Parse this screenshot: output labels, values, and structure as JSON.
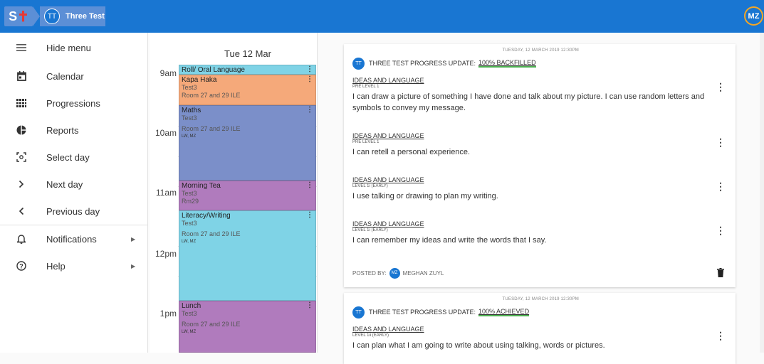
{
  "topbar": {
    "logo_text": "st",
    "breadcrumb": {
      "avatar": "TT",
      "name": "Three Test"
    },
    "user_avatar": "MZ",
    "colors": {
      "bar": "#1976d2",
      "crumb": "#5c8fd6"
    }
  },
  "sidebar": {
    "items": [
      {
        "label": "Hide menu",
        "icon": "menu-icon"
      },
      {
        "label": "Calendar",
        "icon": "calendar-icon"
      },
      {
        "label": "Progressions",
        "icon": "grid-icon"
      },
      {
        "label": "Reports",
        "icon": "pie-chart-icon"
      },
      {
        "label": "Select day",
        "icon": "select-day-icon"
      },
      {
        "label": "Next day",
        "icon": "chevron-right-icon"
      },
      {
        "label": "Previous day",
        "icon": "chevron-left-icon"
      },
      {
        "label": "Notifications",
        "icon": "bell-icon",
        "has_submenu": true
      },
      {
        "label": "Help",
        "icon": "help-icon",
        "has_submenu": true
      }
    ]
  },
  "calendar": {
    "day_label": "Tue 12 Mar",
    "times": [
      "9am",
      "10am",
      "11am",
      "12pm",
      "1pm"
    ],
    "events": [
      {
        "title": "Roll/ Oral Language",
        "subject": "",
        "room": "",
        "who": "",
        "color": "#7fd3e6"
      },
      {
        "title": "Kapa Haka",
        "subject": "Test3",
        "room": "Room 27 and 29 ILE",
        "who": "",
        "color": "#f5a97a"
      },
      {
        "title": "Maths",
        "subject": "Test3",
        "room": "Room 27 and 29 ILE",
        "who": "LW, MZ",
        "color": "#7b8fc9"
      },
      {
        "title": "Morning Tea",
        "subject": "Test3",
        "room": "Rm29",
        "who": "",
        "color": "#b07bbd"
      },
      {
        "title": "Literacy/Writing",
        "subject": "Test3",
        "room": "Room 27 and 29 ILE",
        "who": "LW, MZ",
        "color": "#7fd3e6"
      },
      {
        "title": "Lunch",
        "subject": "Test3",
        "room": "Room 27 and 29 ILE",
        "who": "LW, MZ",
        "color": "#b07bbd"
      }
    ]
  },
  "feed": {
    "cards": [
      {
        "date": "TUESDAY, 12 MARCH 2019 12:30PM",
        "avatar": "TT",
        "title": "THREE TEST  PROGRESS UPDATE:",
        "status": "100% BACKFILLED",
        "items": [
          {
            "category": "IDEAS AND LANGUAGE",
            "level": "PRE LEVEL 1",
            "desc": "I can draw a picture of something I have done and talk about my picture. I can use random letters and symbols to convey my message."
          },
          {
            "category": "IDEAS AND LANGUAGE",
            "level": "PRE LEVEL 1",
            "desc": "I can retell a personal experience."
          },
          {
            "category": "IDEAS AND LANGUAGE",
            "level": "LEVEL 1i (EARLY)",
            "desc": "I use talking or drawing to plan my writing."
          },
          {
            "category": "IDEAS AND LANGUAGE",
            "level": "LEVEL 1i (EARLY)",
            "desc": "I can remember my ideas and write the words that I say."
          }
        ],
        "posted_by_label": "POSTED BY:",
        "poster_avatar": "MZ",
        "poster_name": "MEGHAN ZUYL"
      },
      {
        "date": "TUESDAY, 12 MARCH 2019 12:30PM",
        "avatar": "TT",
        "title": "THREE TEST  PROGRESS UPDATE:",
        "status": "100% ACHIEVED",
        "items": [
          {
            "category": "IDEAS AND LANGUAGE",
            "level": "LEVEL 1ii (EARLY)",
            "desc": "I can plan what I am going to write about using talking, words or pictures."
          }
        ]
      }
    ]
  }
}
